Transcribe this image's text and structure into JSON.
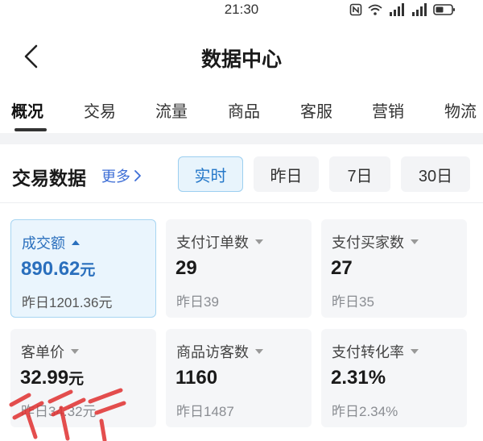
{
  "status_bar": {
    "time": "21:30"
  },
  "header": {
    "title": "数据中心"
  },
  "tabs": [
    {
      "label": "概况",
      "active": true
    },
    {
      "label": "交易"
    },
    {
      "label": "流量"
    },
    {
      "label": "商品"
    },
    {
      "label": "客服"
    },
    {
      "label": "营销"
    },
    {
      "label": "物流"
    }
  ],
  "section": {
    "title": "交易数据",
    "more_label": "更多",
    "ranges": [
      {
        "label": "实时",
        "active": true
      },
      {
        "label": "昨日"
      },
      {
        "label": "7日"
      },
      {
        "label": "30日"
      }
    ]
  },
  "metrics": [
    {
      "label": "成交额",
      "value": "890.62",
      "unit": "元",
      "compare": "昨日1201.36元",
      "selected": true,
      "trend": "up"
    },
    {
      "label": "支付订单数",
      "value": "29",
      "unit": "",
      "compare": "昨日39"
    },
    {
      "label": "支付买家数",
      "value": "27",
      "unit": "",
      "compare": "昨日35"
    },
    {
      "label": "客单价",
      "value": "32.99",
      "unit": "元",
      "compare": "昨日34.32元"
    },
    {
      "label": "商品访客数",
      "value": "1160",
      "unit": "",
      "compare": "昨日1487"
    },
    {
      "label": "支付转化率",
      "value": "2.31%",
      "unit": "",
      "compare": "昨日2.34%"
    }
  ],
  "colors": {
    "accent": "#2a6fbd",
    "link": "#3d6ed6",
    "watermark": "#e03030"
  },
  "icons": [
    "nfc-icon",
    "wifi-icon",
    "signal-4g-icon",
    "signal-5g-icon",
    "battery-icon",
    "back-arrow-icon",
    "chevron-right-icon",
    "caret-up-icon",
    "caret-down-icon"
  ]
}
